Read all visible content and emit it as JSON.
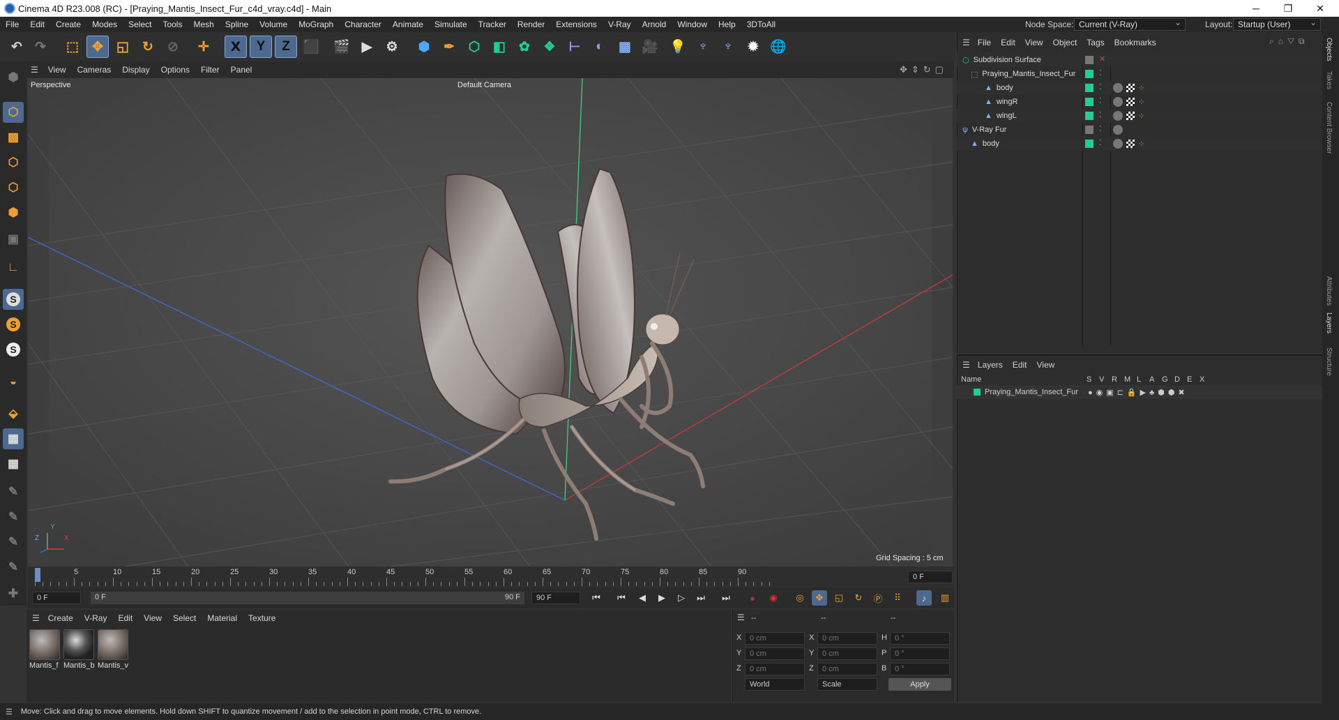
{
  "window": {
    "title": "Cinema 4D R23.008 (RC) - [Praying_Mantis_Insect_Fur_c4d_vray.c4d] - Main",
    "controls": [
      "─",
      "❐",
      "✕"
    ]
  },
  "menu": [
    "File",
    "Edit",
    "Create",
    "Modes",
    "Select",
    "Tools",
    "Mesh",
    "Spline",
    "Volume",
    "MoGraph",
    "Character",
    "Animate",
    "Simulate",
    "Tracker",
    "Render",
    "Extensions",
    "V-Ray",
    "Arnold",
    "Window",
    "Help",
    "3DToAll"
  ],
  "node_space": {
    "label": "Node Space:",
    "value": "Current (V-Ray)"
  },
  "layout": {
    "label": "Layout:",
    "value": "Startup (User)"
  },
  "toolbar": {
    "axis_x": "X",
    "axis_y": "Y",
    "axis_z": "Z"
  },
  "side_s": "S",
  "viewport": {
    "menu": [
      "View",
      "Cameras",
      "Display",
      "Options",
      "Filter",
      "Panel"
    ],
    "label": "Perspective",
    "camera": "Default Camera",
    "grid_spacing": "Grid Spacing : 5 cm",
    "axis_x": "X",
    "axis_y": "Y",
    "axis_z": "Z"
  },
  "timeline": {
    "ticks": [
      "0",
      "5",
      "10",
      "15",
      "20",
      "25",
      "30",
      "35",
      "40",
      "45",
      "50",
      "55",
      "60",
      "65",
      "70",
      "75",
      "80",
      "85",
      "90"
    ],
    "current": "0 F",
    "playhead": 0
  },
  "transport": {
    "start": "0 F",
    "range_start": "0 F",
    "range_end": "90 F",
    "end": "90 F"
  },
  "materials": {
    "menu": [
      "Create",
      "V-Ray",
      "Edit",
      "View",
      "Select",
      "Material",
      "Texture"
    ],
    "items": [
      "Mantis_f",
      "Mantis_b",
      "Mantis_v"
    ]
  },
  "coords": {
    "h1": "--",
    "h2": "--",
    "h3": "--",
    "rows": [
      {
        "a": "X",
        "v1": "0 cm",
        "b": "X",
        "v2": "0 cm",
        "c": "H",
        "v3": "0 °"
      },
      {
        "a": "Y",
        "v1": "0 cm",
        "b": "Y",
        "v2": "0 cm",
        "c": "P",
        "v3": "0 °"
      },
      {
        "a": "Z",
        "v1": "0 cm",
        "b": "Z",
        "v2": "0 cm",
        "c": "B",
        "v3": "0 °"
      }
    ],
    "world": "World",
    "scale": "Scale",
    "apply": "Apply"
  },
  "objects": {
    "menu": [
      "File",
      "Edit",
      "View",
      "Object",
      "Tags",
      "Bookmarks"
    ],
    "rows": [
      "Subdivision Surface",
      "Praying_Mantis_Insect_Fur",
      "body",
      "wingR",
      "wingL",
      "V-Ray Fur",
      "body"
    ]
  },
  "layers": {
    "menu": [
      "Layers",
      "Edit",
      "View"
    ],
    "col_name": "Name",
    "cols": [
      "S",
      "V",
      "R",
      "M",
      "L",
      "A",
      "G",
      "D",
      "E",
      "X"
    ],
    "rows": [
      "Praying_Mantis_Insect_Fur"
    ]
  },
  "side_tabs": [
    "Objects",
    "Takes",
    "Content Browser",
    "Attributes",
    "Layers",
    "Structure"
  ],
  "status": "Move: Click and drag to move elements. Hold down SHIFT to quantize movement / add to the selection in point mode, CTRL to remove.",
  "colors": {
    "accent": "#4d6990",
    "green": "#20d090",
    "orange": "#f0a030"
  }
}
